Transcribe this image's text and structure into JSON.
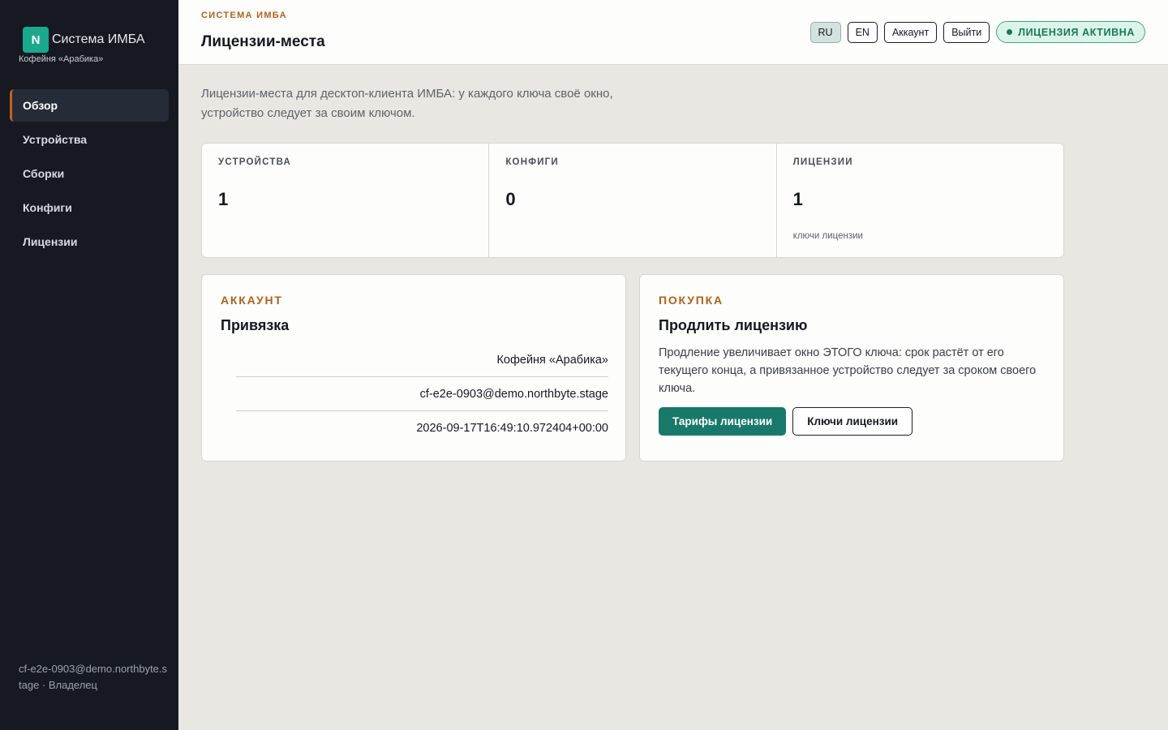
{
  "sidebar": {
    "logo_letter": "N",
    "brand_name": "Система ИМБА",
    "org_name": "Кофейня «Арабика»",
    "nav": [
      {
        "label": "Обзор"
      },
      {
        "label": "Устройства"
      },
      {
        "label": "Сборки"
      },
      {
        "label": "Конфиги"
      },
      {
        "label": "Лицензии"
      }
    ],
    "active_item": "Обзор",
    "footer": "cf-e2e-0903@demo.northbyte.stage · Владелец"
  },
  "header": {
    "eyebrow": "СИСТЕМА ИМБА",
    "title": "Лицензии-места",
    "lang_ru": "RU",
    "lang_en": "EN",
    "account_label": "Аккаунт",
    "logout_label": "Выйти",
    "license_status": "ЛИЦЕНЗИЯ АКТИВНА"
  },
  "main": {
    "intro": "Лицензии-места для десктоп-клиента ИМБА: у каждого ключа своё окно, устройство следует за своим ключом.",
    "stats": [
      {
        "label": "УСТРОЙСТВА",
        "value": "1",
        "note": ""
      },
      {
        "label": "КОНФИГИ",
        "value": "0",
        "note": ""
      },
      {
        "label": "ЛИЦЕНЗИИ",
        "value": "1",
        "note": "ключи лицензии"
      }
    ],
    "account_card": {
      "eyebrow": "АККАУНТ",
      "title": "Привязка",
      "org": "Кофейня «Арабика»",
      "email": "cf-e2e-0903@demo.northbyte.stage",
      "timestamp": "2026-09-17T16:49:10.972404+00:00"
    },
    "purchase_card": {
      "eyebrow": "ПОКУПКА",
      "title": "Продлить лицензию",
      "text": "Продление увеличивает окно ЭТОГО ключа: срок растёт от его текущего конца, а привязанное устройство следует за сроком своего ключа.",
      "primary_button": "Тарифы лицензии",
      "secondary_button": "Ключи лицензии"
    }
  },
  "colors": {
    "sidebar_bg": "#161922",
    "accent_orange": "#b0621c",
    "primary_teal": "#18796a",
    "logo_green": "#1ba88c",
    "badge_green": "#157a5b"
  }
}
